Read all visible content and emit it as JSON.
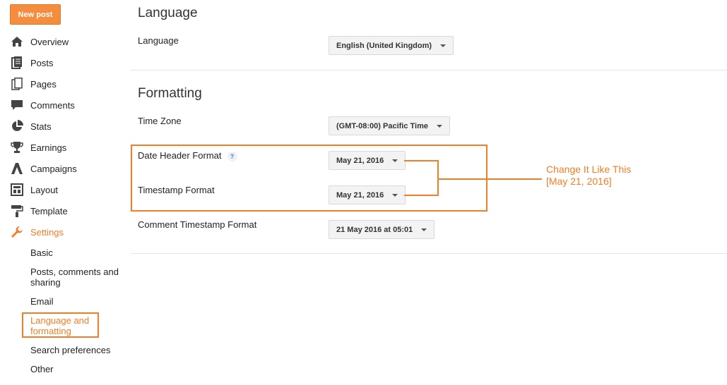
{
  "sidebar": {
    "new_post": "New post",
    "nav": [
      {
        "label": "Overview",
        "icon": "home-icon"
      },
      {
        "label": "Posts",
        "icon": "posts-icon"
      },
      {
        "label": "Pages",
        "icon": "pages-icon"
      },
      {
        "label": "Comments",
        "icon": "comment-icon"
      },
      {
        "label": "Stats",
        "icon": "pie-chart-icon"
      },
      {
        "label": "Earnings",
        "icon": "trophy-icon"
      },
      {
        "label": "Campaigns",
        "icon": "campaigns-icon"
      },
      {
        "label": "Layout",
        "icon": "layout-icon"
      },
      {
        "label": "Template",
        "icon": "paint-roller-icon"
      },
      {
        "label": "Settings",
        "icon": "wrench-icon",
        "active": true
      }
    ],
    "settings_sub": [
      {
        "label": "Basic"
      },
      {
        "label": "Posts, comments and\nsharing"
      },
      {
        "label": "Email"
      },
      {
        "label": "Language and\nformatting",
        "active": true
      },
      {
        "label": "Search preferences"
      },
      {
        "label": "Other"
      }
    ]
  },
  "main": {
    "language_section": {
      "title": "Language",
      "language_label": "Language",
      "language_value": "English (United Kingdom)"
    },
    "formatting_section": {
      "title": "Formatting",
      "timezone_label": "Time Zone",
      "timezone_value": "(GMT-08:00) Pacific Time",
      "date_header_label": "Date Header Format",
      "date_header_help": "?",
      "date_header_value": "May 21, 2016",
      "timestamp_label": "Timestamp Format",
      "timestamp_value": "May 21, 2016",
      "comment_timestamp_label": "Comment Timestamp Format",
      "comment_timestamp_value": "21 May 2016 at 05:01"
    }
  },
  "annotation": {
    "text": "Change It Like This\n[May 21, 2016]",
    "color": "#f37c24"
  },
  "colors": {
    "accent": "#f37c24",
    "button": "#f48d3d"
  }
}
